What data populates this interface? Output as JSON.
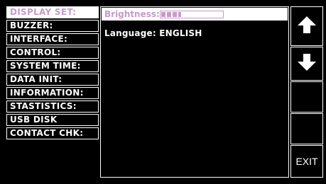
{
  "menu": {
    "items": [
      {
        "label": "DISPLAY SET:",
        "active": true
      },
      {
        "label": "BUZZER:",
        "active": false
      },
      {
        "label": "INTERFACE:",
        "active": false
      },
      {
        "label": "CONTROL:",
        "active": false
      },
      {
        "label": "SYSTEM TIME:",
        "active": false
      },
      {
        "label": "DATA INIT:",
        "active": false
      },
      {
        "label": "INFORMATION:",
        "active": false
      },
      {
        "label": "STASTISTICS:",
        "active": false
      },
      {
        "label": "USB DISK",
        "active": false
      },
      {
        "label": "CONTACT CHK:",
        "active": false
      }
    ]
  },
  "settings": {
    "brightness_label": "Brightness:",
    "brightness_level": 0.35,
    "language_label": "Language: ENGLISH"
  },
  "side_buttons": {
    "up_icon": "up-arrow-icon",
    "down_icon": "down-arrow-icon",
    "exit_label": "EXIT"
  },
  "colors": {
    "accent": "#c89ac8",
    "background": "#000000",
    "foreground": "#ffffff"
  }
}
